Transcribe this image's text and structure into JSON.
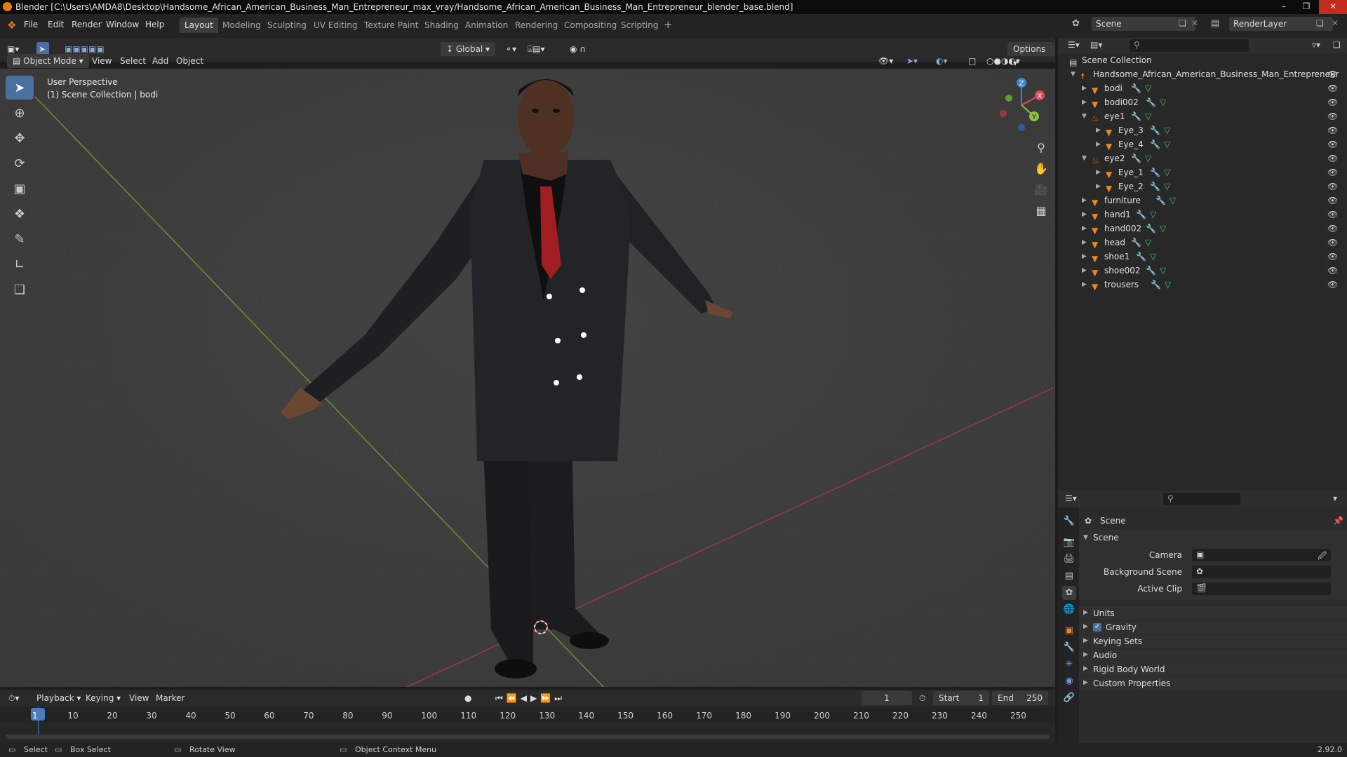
{
  "title_bar": {
    "text": "Blender [C:\\Users\\AMDA8\\Desktop\\Handsome_African_American_Business_Man_Entrepreneur_max_vray/Handsome_African_American_Business_Man_Entrepreneur_blender_base.blend]"
  },
  "menus": [
    "File",
    "Edit",
    "Render",
    "Window",
    "Help"
  ],
  "workspaces": [
    "Layout",
    "Modeling",
    "Sculpting",
    "UV Editing",
    "Texture Paint",
    "Shading",
    "Animation",
    "Rendering",
    "Compositing",
    "Scripting"
  ],
  "active_workspace": "Layout",
  "scene_field": "Scene",
  "view_layer_field": "RenderLayer",
  "viewport": {
    "mode": "Object Mode",
    "menus": [
      "View",
      "Select",
      "Add",
      "Object"
    ],
    "transform_orientation": "Global",
    "options_label": "Options",
    "info_line1": "User Perspective",
    "info_line2": "(1) Scene Collection | bodi",
    "gizmo_axes": {
      "x": "X",
      "y": "Y",
      "z": "Z"
    }
  },
  "outliner": {
    "root": "Scene Collection",
    "collection": "Handsome_African_American_Business_Man_Entrepreneur",
    "items": [
      {
        "name": "bodi",
        "indent": 1,
        "expanded": false,
        "type": "mesh"
      },
      {
        "name": "bodi002",
        "indent": 1,
        "expanded": false,
        "type": "mesh"
      },
      {
        "name": "eye1",
        "indent": 1,
        "expanded": true,
        "type": "empty"
      },
      {
        "name": "Eye_3",
        "indent": 2,
        "expanded": false,
        "type": "mesh"
      },
      {
        "name": "Eye_4",
        "indent": 2,
        "expanded": false,
        "type": "mesh"
      },
      {
        "name": "eye2",
        "indent": 1,
        "expanded": true,
        "type": "empty"
      },
      {
        "name": "Eye_1",
        "indent": 2,
        "expanded": false,
        "type": "mesh"
      },
      {
        "name": "Eye_2",
        "indent": 2,
        "expanded": false,
        "type": "mesh"
      },
      {
        "name": "furniture",
        "indent": 1,
        "expanded": false,
        "type": "mesh"
      },
      {
        "name": "hand1",
        "indent": 1,
        "expanded": false,
        "type": "mesh"
      },
      {
        "name": "hand002",
        "indent": 1,
        "expanded": false,
        "type": "mesh"
      },
      {
        "name": "head",
        "indent": 1,
        "expanded": false,
        "type": "mesh"
      },
      {
        "name": "shoe1",
        "indent": 1,
        "expanded": false,
        "type": "mesh"
      },
      {
        "name": "shoe002",
        "indent": 1,
        "expanded": false,
        "type": "mesh"
      },
      {
        "name": "trousers",
        "indent": 1,
        "expanded": false,
        "type": "mesh"
      }
    ]
  },
  "properties": {
    "context": "Scene",
    "panel": "Scene",
    "camera_label": "Camera",
    "background_scene_label": "Background Scene",
    "active_clip_label": "Active Clip",
    "sections": [
      "Units",
      "Gravity",
      "Keying Sets",
      "Audio",
      "Rigid Body World",
      "Custom Properties"
    ],
    "gravity_checked": true
  },
  "timeline": {
    "menus": [
      "Playback",
      "Keying",
      "View",
      "Marker"
    ],
    "current_frame": "1",
    "start_label": "Start",
    "start_value": "1",
    "end_label": "End",
    "end_value": "250",
    "ticks": [
      "1",
      "10",
      "20",
      "30",
      "40",
      "50",
      "60",
      "70",
      "80",
      "90",
      "100",
      "110",
      "120",
      "130",
      "140",
      "150",
      "160",
      "170",
      "180",
      "190",
      "200",
      "210",
      "220",
      "230",
      "240",
      "250"
    ]
  },
  "status_bar": {
    "select": "Select",
    "box_select": "Box Select",
    "rotate_view": "Rotate View",
    "context_menu": "Object Context Menu",
    "version": "2.92.0"
  },
  "colors": {
    "accent": "#4a6fa0",
    "x_axis": "#e04a5a",
    "y_axis": "#8ac43e",
    "z_axis": "#3c85d9",
    "mesh_icon": "#e8862a"
  }
}
